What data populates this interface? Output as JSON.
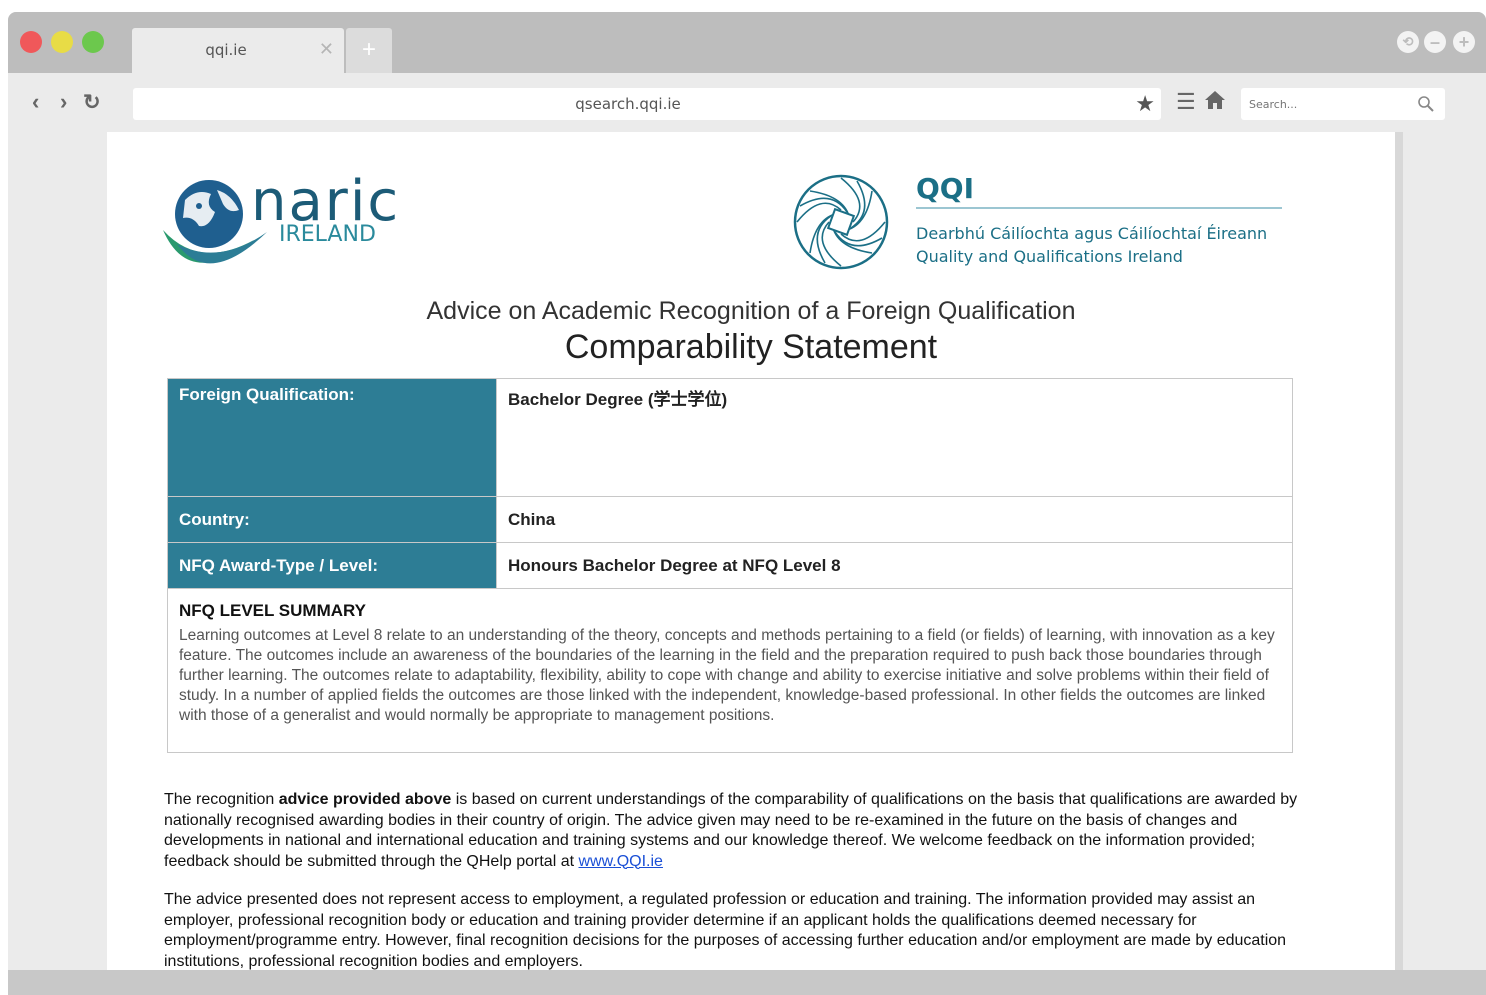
{
  "browser": {
    "tab_title": "qqi.ie",
    "url": "qsearch.qqi.ie",
    "search_placeholder": "Search...",
    "colors": {
      "close": "#f0585a",
      "minimize": "#e8dc46",
      "maximize": "#6cc84d"
    }
  },
  "document": {
    "naric_logo": {
      "word": "naric",
      "sub": "IRELAND"
    },
    "qqi_logo": {
      "word": "QQI",
      "line_irish": "Dearbhú Cáilíochta agus Cáilíochtaí Éireann",
      "line_english": "Quality and Qualifications Ireland"
    },
    "subtitle": "Advice on Academic Recognition of a Foreign Qualification",
    "title": "Comparability Statement",
    "rows": [
      {
        "label": "Foreign Qualification:",
        "value": "Bachelor Degree (学士学位)"
      },
      {
        "label": "Country:",
        "value": "China"
      },
      {
        "label": "NFQ Award-Type / Level:",
        "value": "Honours Bachelor Degree at NFQ Level 8"
      }
    ],
    "summary": {
      "heading": "NFQ LEVEL SUMMARY",
      "body": "Learning outcomes at Level 8 relate to an understanding of the theory, concepts and methods pertaining to a field (or fields) of learning, with innovation as a key feature. The outcomes include an awareness of the boundaries of the learning in the field and the preparation required to push back those boundaries through further learning. The outcomes relate to adaptability, flexibility, ability to cope with change and ability to exercise initiative and solve problems within their field of study. In a number of applied fields the outcomes are those linked with the independent, knowledge-based professional. In other fields the outcomes are linked with those of a generalist and would normally be appropriate to management positions."
    },
    "para1": {
      "lead": "The recognition ",
      "bold": "advice provided above",
      "rest": " is based on current understandings of the comparability of qualifications on the basis that qualifications are awarded by nationally recognised awarding bodies in their country of origin. The advice given may need to be re-examined in the future on the basis of changes and developments in national and international education and training systems and our knowledge thereof. We welcome feedback on the information provided; feedback should be submitted through the QHelp portal at ",
      "link": "www.QQI.ie"
    },
    "para2": "The advice presented does not represent access to employment, a regulated profession or education and training. The information provided may assist an employer, professional recognition body or education and training provider determine if an applicant holds the qualifications deemed necessary for employment/programme entry. However, final recognition decisions for the purposes of accessing further education and/or employment are made by education institutions, professional recognition bodies and employers."
  }
}
